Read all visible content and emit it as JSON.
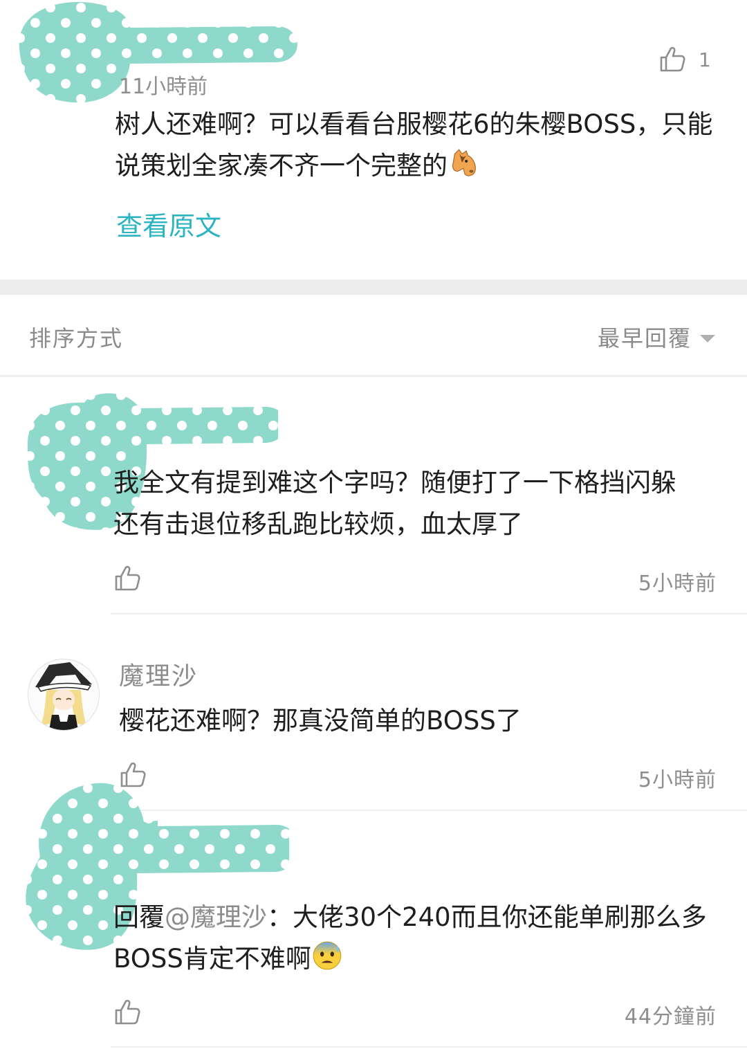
{
  "top_comment": {
    "time": "11小時前",
    "like_count": "1",
    "text_line1": "树人还难啊？可以看看台服樱花6的朱樱BOSS，只能",
    "text_line2": "说策划全家凑不齐一个完整的",
    "emoji_icon": "horse-face-icon",
    "view_original": "查看原文"
  },
  "sort": {
    "label": "排序方式",
    "selected": "最早回覆"
  },
  "replies": [
    {
      "text_line1": "我全文有提到难这个字吗？随便打了一下格挡闪躲",
      "text_line2": "还有击退位移乱跑比较烦，血太厚了",
      "time": "5小時前"
    },
    {
      "username": "魔理沙",
      "text": "樱花还难啊？那真没简单的BOSS了",
      "time": "5小時前"
    },
    {
      "reply_prefix": "回覆",
      "mention": "@魔理沙",
      "text_line1_rest": "：大佬30个240而且你还能单刷那么多",
      "text_line2": "BOSS肯定不难啊",
      "emoji_icon": "anxious-face-with-sweat-icon",
      "time": "44分鐘前"
    }
  ],
  "colors": {
    "link": "#2bb3c2",
    "redaction": "#8fd9cc",
    "muted": "#8e8e8e"
  }
}
